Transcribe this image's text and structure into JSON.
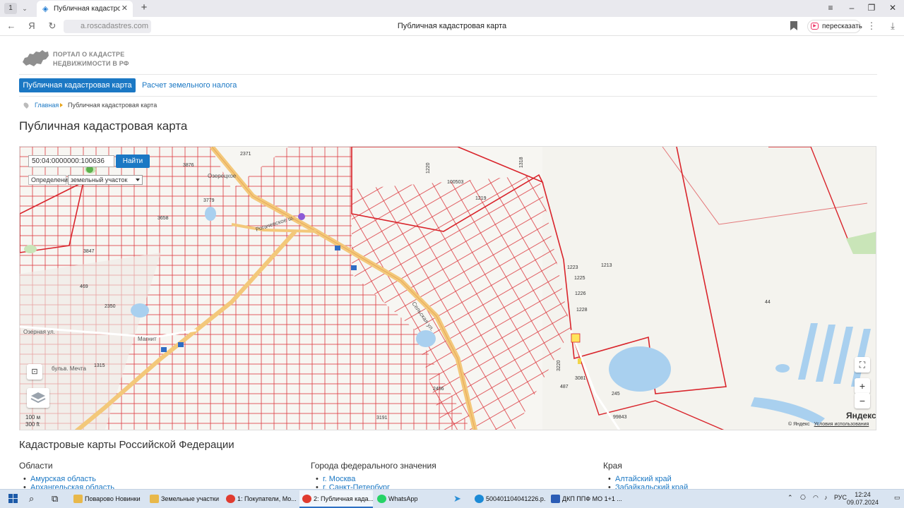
{
  "browser": {
    "tab_count": "1",
    "tab_title": "Публичная кадастровая",
    "url": "a.roscadastres.com",
    "page_title": "Публичная кадастровая карта",
    "retell_label": "пересказать"
  },
  "portal": {
    "logo_line1": "ПОРТАЛ О КАДАСТРЕ",
    "logo_line2": "НЕДВИЖИМОСТИ В РФ"
  },
  "nav": {
    "active": "Публичная кадастровая карта",
    "link": "Расчет земельного налога"
  },
  "breadcrumb": {
    "home": "Главная",
    "current": "Публичная кадастровая карта"
  },
  "heading": "Публичная кадастровая карта",
  "map": {
    "search_value": "50:04:0000000:100636",
    "search_button": "Найти",
    "definition_label": "Определение",
    "definition_select": "земельный участок",
    "scale_line1": "100 м",
    "scale_line2": "300 ft",
    "yandex_logo": "Яндекс",
    "copyright": "© Яндекс",
    "terms": "Условия использования",
    "parcel_labels": [
      "100503",
      "1219",
      "1213",
      "44",
      "99843",
      "2371",
      "3876",
      "1220",
      "1318",
      "3779",
      "3658",
      "2350",
      "469",
      "3847",
      "1315",
      "3191",
      "2456",
      "3081",
      "245",
      "1223",
      "1225",
      "1226",
      "1228",
      "3220",
      "487"
    ],
    "street_labels": [
      "Озерецкое",
      "Рогачевское ш.",
      "Магнит",
      "бульв. Мечта",
      "Озерная ул.",
      "Сельская ул."
    ]
  },
  "regions": {
    "heading": "Кадастровые карты Российской Федерации",
    "columns": [
      {
        "title": "Области",
        "items": [
          "Амурская область",
          "Архангельская область"
        ]
      },
      {
        "title": "Города федерального значения",
        "items": [
          "г. Москва",
          "г. Санкт-Петербург"
        ]
      },
      {
        "title": "Края",
        "items": [
          "Алтайский край",
          "Забайкальский край"
        ]
      }
    ]
  },
  "taskbar": {
    "items": [
      "Поварово Новинки",
      "Земельные участки",
      "1: Покупатели, Мо...",
      "2: Публичная када...",
      "WhatsApp",
      "500401104041226.p...",
      "ДКП ППФ МО 1+1 ..."
    ],
    "lang": "РУС",
    "time": "12:24",
    "date": "09.07.2024"
  },
  "colors": {
    "accent": "#1b78c4",
    "parcel_border": "#d9242b",
    "road": "#f3c87a",
    "water": "#a9d0ef"
  }
}
